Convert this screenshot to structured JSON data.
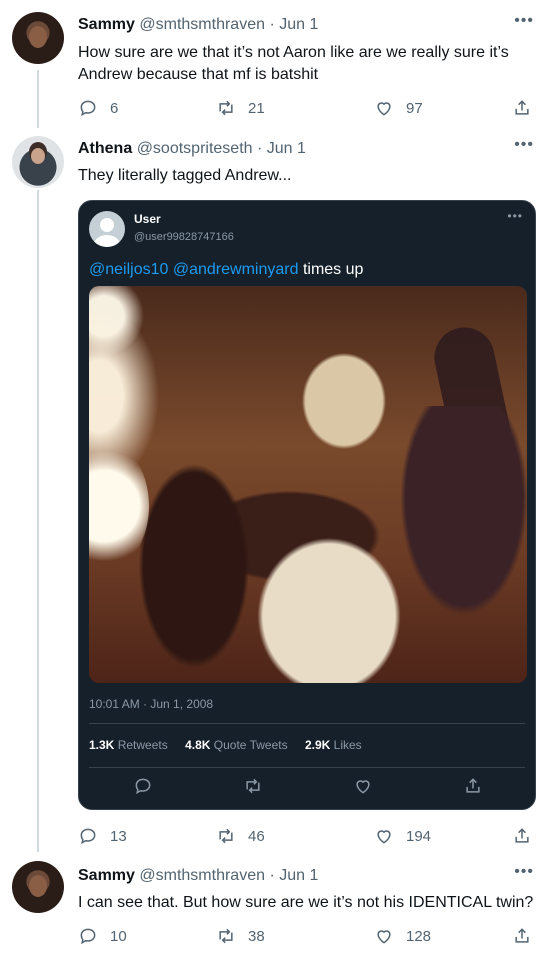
{
  "tweets": [
    {
      "name": "Sammy",
      "handle": "@smthsmthraven",
      "date": "· Jun 1",
      "text": "How sure are we that it’s not Aaron like are we really sure it’s Andrew because that mf is batshit",
      "replies": "6",
      "retweets": "21",
      "likes": "97"
    },
    {
      "name": "Athena",
      "handle": "@sootspriteseth",
      "date": "· Jun 1",
      "text": "They literally tagged Andrew...",
      "replies": "13",
      "retweets": "46",
      "likes": "194"
    },
    {
      "name": "Sammy",
      "handle": "@smthsmthraven",
      "date": "· Jun 1",
      "text": "I can see that. But how sure are we it’s not his IDENTICAL twin?",
      "replies": "10",
      "retweets": "38",
      "likes": "128"
    }
  ],
  "embed": {
    "name": "User",
    "handle": "@user99828747166",
    "mention1": "@neiljos10",
    "mention2": "@andrewminyard",
    "text_rest": "times up",
    "timestamp": "10:01 AM · Jun 1, 2008",
    "retweets_count": "1.3K",
    "retweets_label": "Retweets",
    "quotes_count": "4.8K",
    "quotes_label": "Quote Tweets",
    "likes_count": "2.9K",
    "likes_label": "Likes"
  },
  "more_glyph": "•••",
  "colors": {
    "accent": "#1d9bf0",
    "muted": "#536471",
    "embed_bg": "#15202b"
  }
}
